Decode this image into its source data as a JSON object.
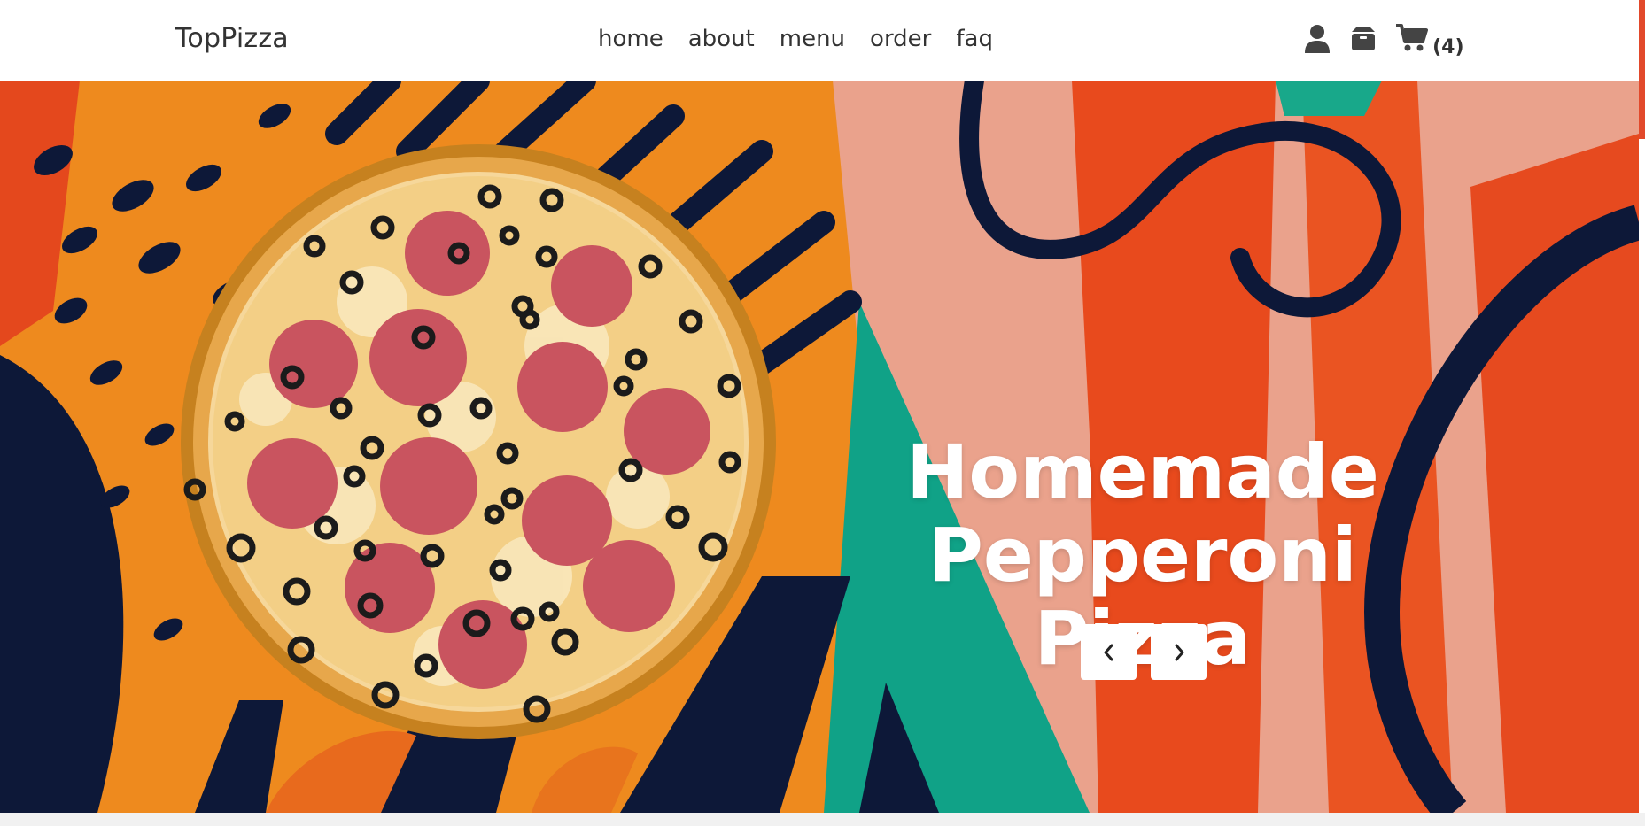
{
  "header": {
    "logo": "TopPizza",
    "nav": [
      {
        "label": "home"
      },
      {
        "label": "about"
      },
      {
        "label": "menu"
      },
      {
        "label": "order"
      },
      {
        "label": "faq"
      }
    ],
    "icons": {
      "user": "user-icon",
      "box": "box-icon",
      "cart": "cart-icon"
    },
    "cart_count": "(4)"
  },
  "hero": {
    "title_line1": "Homemade",
    "title_line2": "Pepperoni Pizza",
    "prev_icon": "chevron-left-icon",
    "next_icon": "chevron-right-icon"
  },
  "colors": {
    "accent": "#e2492b",
    "orange": "#f0871c",
    "navy": "#0d1838",
    "teal": "#0fa487",
    "peach": "#eda58f",
    "red_orange": "#e9481e"
  }
}
